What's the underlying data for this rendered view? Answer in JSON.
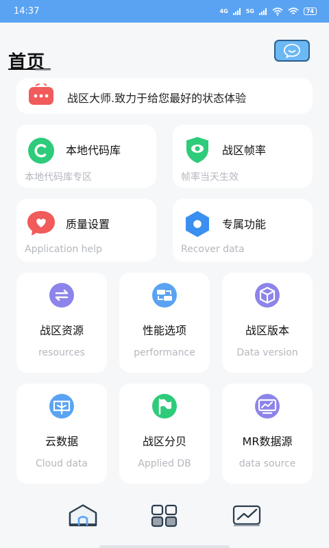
{
  "status_bar": {
    "time": "14:37",
    "signal1": "4G",
    "signal2": "5G",
    "battery": "74"
  },
  "header": {
    "title": "首页"
  },
  "banner": {
    "text": "战区大师.致力于给您最好的状态体验"
  },
  "wide_cards": [
    {
      "title": "本地代码库",
      "subtitle": "本地代码库专区",
      "icon": "c-letter-icon",
      "color": "#2ecb7a"
    },
    {
      "title": "战区帧率",
      "subtitle": "帧率当天生效",
      "icon": "shield-eye-icon",
      "color": "#2ecb7a"
    },
    {
      "title": "质量设置",
      "subtitle": "Application help",
      "icon": "heart-bubble-icon",
      "color": "#f15b5b"
    },
    {
      "title": "专属功能",
      "subtitle": "Recover data",
      "icon": "hexagon-icon",
      "color": "#3a8ff0"
    }
  ],
  "small_cards": [
    {
      "title": "战区资源",
      "subtitle": "resources",
      "icon": "sync-icon",
      "color": "#8c84ea"
    },
    {
      "title": "性能选项",
      "subtitle": "performance",
      "icon": "swap-icon",
      "color": "#5aa3f2"
    },
    {
      "title": "战区版本",
      "subtitle": "Data version",
      "icon": "cube-icon",
      "color": "#8c84ea"
    },
    {
      "title": "云数据",
      "subtitle": "Cloud data",
      "icon": "cloud-box-icon",
      "color": "#5aa3f2"
    },
    {
      "title": "战区分贝",
      "subtitle": "Applied DB",
      "icon": "flag-icon",
      "color": "#2ecb7a"
    },
    {
      "title": "MR数据源",
      "subtitle": "data source",
      "icon": "monitor-icon",
      "color": "#8c84ea"
    }
  ],
  "bottom_nav": [
    {
      "name": "home",
      "icon": "home-icon"
    },
    {
      "name": "apps",
      "icon": "grid-icon"
    },
    {
      "name": "stats",
      "icon": "chart-icon"
    }
  ]
}
